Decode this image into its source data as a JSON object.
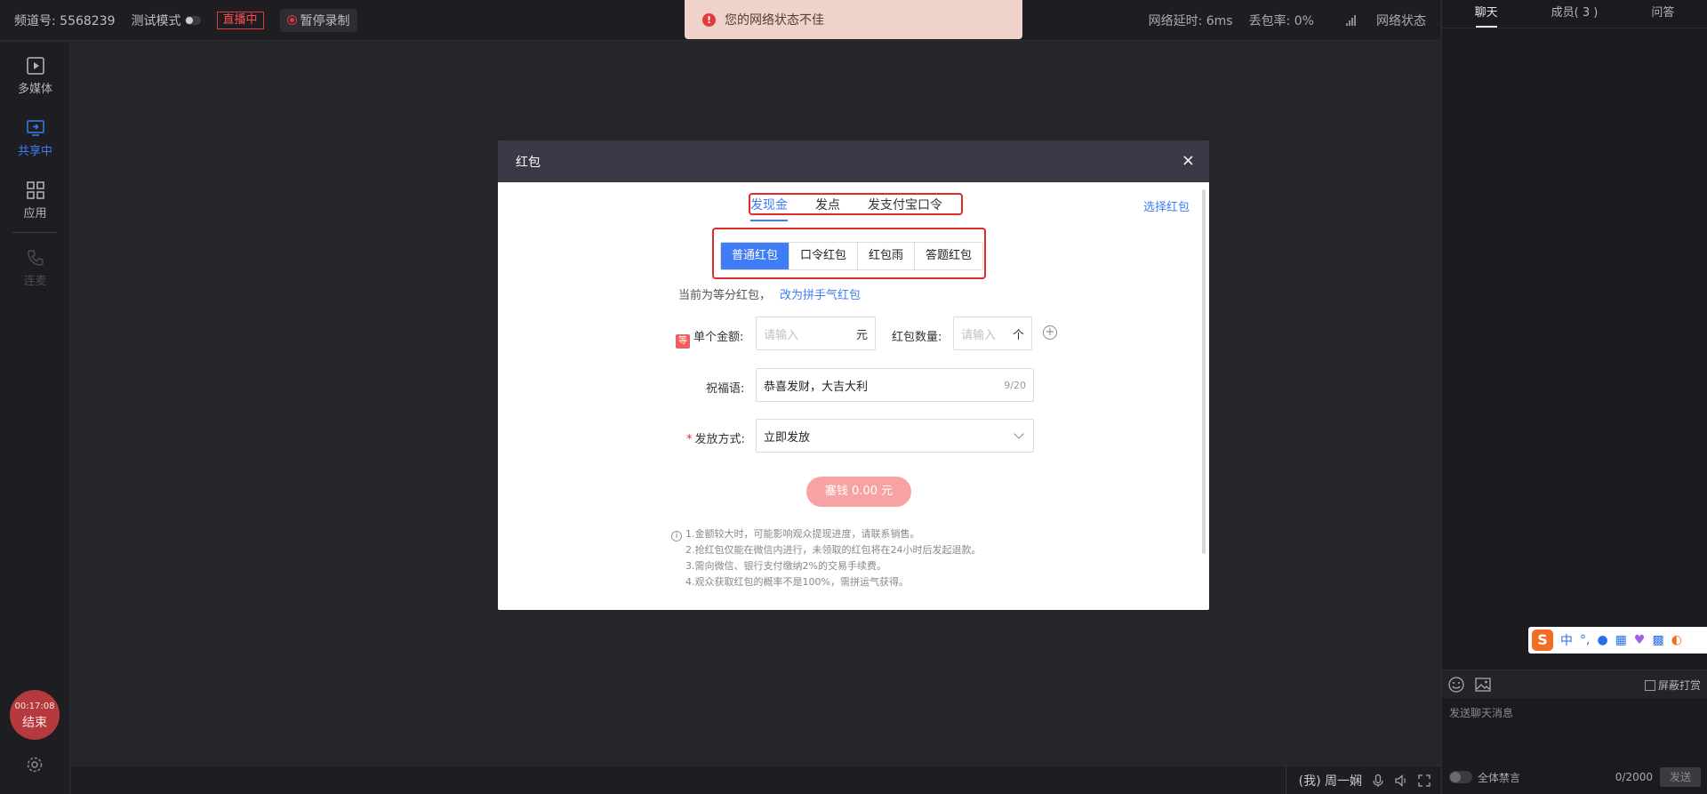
{
  "topbar": {
    "channel": "频道号: 5568239",
    "test_mode": "测试模式",
    "live_status": "直播中",
    "pause_record": "暂停录制",
    "latency": "网络延时: 6ms",
    "packet_loss": "丢包率: 0%",
    "network_status": "网络状态"
  },
  "alert": {
    "message": "您的网络状态不佳"
  },
  "sidebar": {
    "items": [
      {
        "label": "多媒体",
        "icon": "play-icon"
      },
      {
        "label": "共享中",
        "icon": "screen-share-icon"
      },
      {
        "label": "应用",
        "icon": "apps-grid-icon"
      },
      {
        "label": "连麦",
        "icon": "phone-icon"
      }
    ],
    "end_time": "00:17:08",
    "end_label": "结束"
  },
  "stage": {
    "user_label": "(我) 周一娴"
  },
  "right_panel": {
    "tabs": [
      "聊天",
      "成员( 3 )",
      "问答"
    ],
    "ime_lang": "中",
    "block_reward": "屏蔽打赏",
    "chat_placeholder": "发送聊天消息",
    "mute_all": "全体禁言",
    "char_count": "0/2000",
    "send": "发送"
  },
  "modal": {
    "title": "红包",
    "close": "×",
    "tabs": [
      "发现金",
      "发点",
      "发支付宝口令"
    ],
    "select_link": "选择红包",
    "types": [
      "普通红包",
      "口令红包",
      "红包雨",
      "答题红包"
    ],
    "mode_text": "当前为等分红包，",
    "mode_link": "改为拼手气红包",
    "amount_label": "单个金额:",
    "deng": "等",
    "amount_placeholder": "请输入",
    "amount_unit": "元",
    "count_label": "红包数量:",
    "count_placeholder": "请输入",
    "count_unit": "个",
    "blessing_label": "祝福语:",
    "blessing_value": "恭喜发财，大吉大利",
    "blessing_count": "9/20",
    "method_label": "发放方式:",
    "method_value": "立即发放",
    "pay_button": "塞钱 0.00 元",
    "notes": [
      "1.金额较大时，可能影响观众提现进度，请联系销售。",
      "2.抢红包仅能在微信内进行，未领取的红包将在24小时后发起退款。",
      "3.需向微信、银行支付缴纳2%的交易手续费。",
      "4.观众获取红包的概率不是100%，需拼运气获得。"
    ]
  },
  "colors": {
    "accent": "#3f7cf5",
    "danger": "#e32a2a",
    "modal_header": "#3a3a47"
  }
}
